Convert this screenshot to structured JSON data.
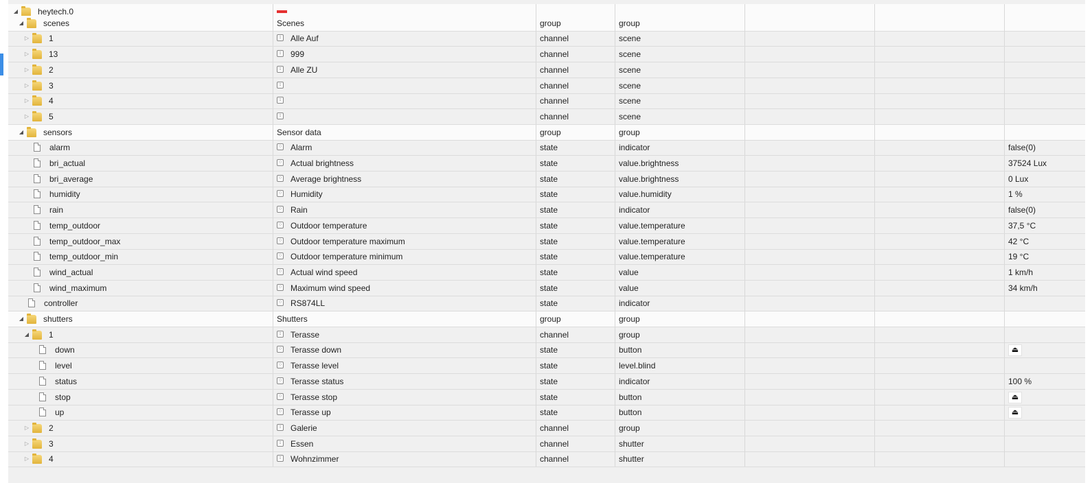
{
  "rows": [
    {
      "id": "heytech.0",
      "name": "",
      "type": "",
      "role": "",
      "value": ""
    },
    {
      "id": "scenes",
      "name": "Scenes",
      "type": "group",
      "role": "group",
      "value": ""
    },
    {
      "id": "1",
      "name": "Alle Auf",
      "type": "channel",
      "role": "scene",
      "value": ""
    },
    {
      "id": "13",
      "name": "999",
      "type": "channel",
      "role": "scene",
      "value": ""
    },
    {
      "id": "2",
      "name": "Alle ZU",
      "type": "channel",
      "role": "scene",
      "value": ""
    },
    {
      "id": "3",
      "name": "",
      "type": "channel",
      "role": "scene",
      "value": ""
    },
    {
      "id": "4",
      "name": "",
      "type": "channel",
      "role": "scene",
      "value": ""
    },
    {
      "id": "5",
      "name": "",
      "type": "channel",
      "role": "scene",
      "value": ""
    },
    {
      "id": "sensors",
      "name": "Sensor data",
      "type": "group",
      "role": "group",
      "value": ""
    },
    {
      "id": "alarm",
      "name": "Alarm",
      "type": "state",
      "role": "indicator",
      "value": "false(0)"
    },
    {
      "id": "bri_actual",
      "name": "Actual brightness",
      "type": "state",
      "role": "value.brightness",
      "value": "37524 Lux"
    },
    {
      "id": "bri_average",
      "name": "Average brightness",
      "type": "state",
      "role": "value.brightness",
      "value": "0 Lux"
    },
    {
      "id": "humidity",
      "name": "Humidity",
      "type": "state",
      "role": "value.humidity",
      "value": "1 %"
    },
    {
      "id": "rain",
      "name": "Rain",
      "type": "state",
      "role": "indicator",
      "value": "false(0)"
    },
    {
      "id": "temp_outdoor",
      "name": "Outdoor temperature",
      "type": "state",
      "role": "value.temperature",
      "value": "37,5 °C"
    },
    {
      "id": "temp_outdoor_max",
      "name": "Outdoor temperature maximum",
      "type": "state",
      "role": "value.temperature",
      "value": "42 °C"
    },
    {
      "id": "temp_outdoor_min",
      "name": "Outdoor temperature minimum",
      "type": "state",
      "role": "value.temperature",
      "value": "19 °C"
    },
    {
      "id": "wind_actual",
      "name": "Actual wind speed",
      "type": "state",
      "role": "value",
      "value": "1 km/h"
    },
    {
      "id": "wind_maximum",
      "name": "Maximum wind speed",
      "type": "state",
      "role": "value",
      "value": "34 km/h"
    },
    {
      "id": "controller",
      "name": "RS874LL",
      "type": "state",
      "role": "indicator",
      "value": ""
    },
    {
      "id": "shutters",
      "name": "Shutters",
      "type": "group",
      "role": "group",
      "value": ""
    },
    {
      "id": "1",
      "name": "Terasse",
      "type": "channel",
      "role": "group",
      "value": ""
    },
    {
      "id": "down",
      "name": "Terasse down",
      "type": "state",
      "role": "button",
      "value": ""
    },
    {
      "id": "level",
      "name": "Terasse level",
      "type": "state",
      "role": "level.blind",
      "value": ""
    },
    {
      "id": "status",
      "name": "Terasse status",
      "type": "state",
      "role": "indicator",
      "value": "100 %"
    },
    {
      "id": "stop",
      "name": "Terasse stop",
      "type": "state",
      "role": "button",
      "value": ""
    },
    {
      "id": "up",
      "name": "Terasse up",
      "type": "state",
      "role": "button",
      "value": ""
    },
    {
      "id": "2",
      "name": "Galerie",
      "type": "channel",
      "role": "group",
      "value": ""
    },
    {
      "id": "3",
      "name": "Essen",
      "type": "channel",
      "role": "shutter",
      "value": ""
    },
    {
      "id": "4",
      "name": "Wohnzimmer",
      "type": "channel",
      "role": "shutter",
      "value": ""
    }
  ],
  "icons": {
    "button_action": "eject-icon",
    "channel": "channel-icon",
    "state": "state-icon",
    "folder": "folder-icon",
    "file": "file-icon"
  }
}
